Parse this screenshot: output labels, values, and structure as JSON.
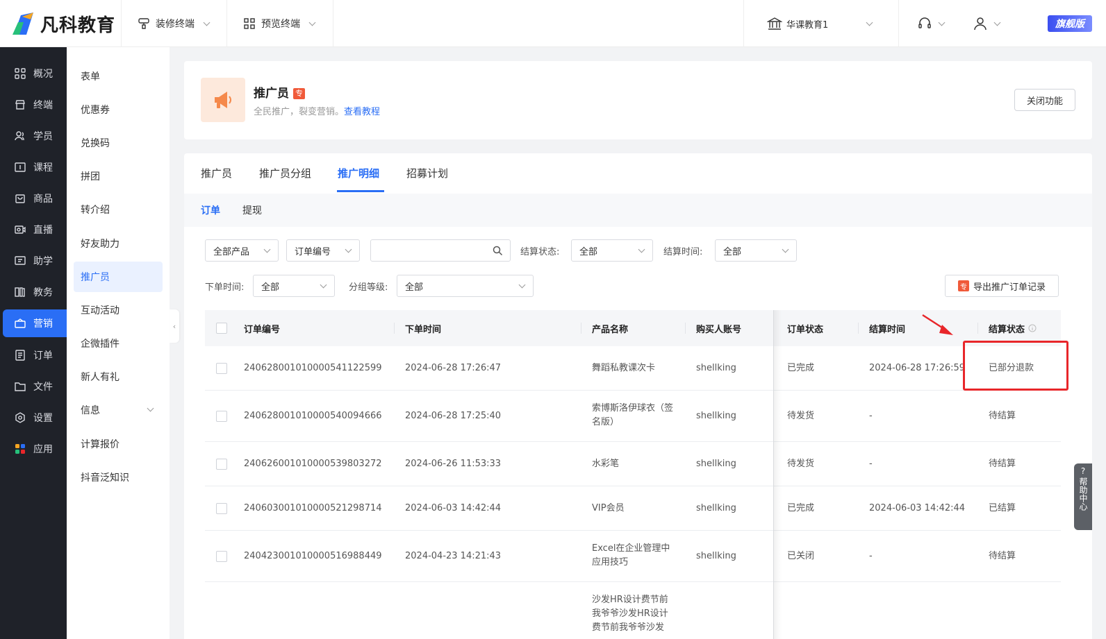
{
  "brand": {
    "name": "凡科教育"
  },
  "topbar": {
    "decorate_label": "装修终端",
    "preview_label": "预览终端",
    "org_name": "华课教育1",
    "vip_label": "旗舰版"
  },
  "nav": {
    "items": [
      {
        "label": "概况",
        "icon": "grid-icon"
      },
      {
        "label": "终端",
        "icon": "store-icon"
      },
      {
        "label": "学员",
        "icon": "users-icon"
      },
      {
        "label": "课程",
        "icon": "course-icon"
      },
      {
        "label": "商品",
        "icon": "bag-icon"
      },
      {
        "label": "直播",
        "icon": "live-icon"
      },
      {
        "label": "助学",
        "icon": "assist-icon"
      },
      {
        "label": "教务",
        "icon": "book-icon"
      },
      {
        "label": "营销",
        "icon": "marketing-icon"
      },
      {
        "label": "订单",
        "icon": "order-icon"
      },
      {
        "label": "文件",
        "icon": "folder-icon"
      },
      {
        "label": "设置",
        "icon": "gear-icon"
      },
      {
        "label": "应用",
        "icon": "apps-icon"
      }
    ],
    "active": "营销"
  },
  "subnav": {
    "items": [
      "表单",
      "优惠券",
      "兑换码",
      "拼团",
      "转介绍",
      "好友助力",
      "推广员",
      "互动活动",
      "企微插件",
      "新人有礼",
      "信息",
      "计算报价",
      "抖音泛知识"
    ],
    "active": "推广员"
  },
  "header": {
    "title": "推广员",
    "badge": "专",
    "desc": "全民推广，裂变营销。",
    "link": "查看教程",
    "close_button": "关闭功能"
  },
  "tabs": [
    "推广员",
    "推广员分组",
    "推广明细",
    "招募计划"
  ],
  "active_tab": "推广明细",
  "subtabs": [
    "订单",
    "提现"
  ],
  "active_subtab": "订单",
  "filters": {
    "product": "全部产品",
    "order_no": "订单编号",
    "search_placeholder": "",
    "settle_status_label": "结算状态:",
    "settle_status_value": "全部",
    "settle_time_label": "结算时间:",
    "settle_time_value": "全部",
    "order_time_label": "下单时间:",
    "order_time_value": "全部",
    "group_level_label": "分组等级:",
    "group_level_value": "全部",
    "export_badge": "专",
    "export_label": "导出推广订单记录"
  },
  "table": {
    "columns": [
      "订单编号",
      "下单时间",
      "产品名称",
      "购买人账号",
      "订单状态",
      "结算时间",
      "结算状态"
    ],
    "rows": [
      {
        "order_no": "24062800101000054112​2599",
        "time": "2024-06-28 17:26:47",
        "product": "舞蹈私教课次卡",
        "buyer": "shellking",
        "status": "已完成",
        "settle_time": "2024-06-28 17:26:59",
        "settle_status": "已部分退款"
      },
      {
        "order_no": "240628001010000540094666",
        "time": "2024-06-28 17:25:40",
        "product": "索博斯洛伊球衣（签名版）",
        "buyer": "shellking",
        "status": "待发货",
        "settle_time": "-",
        "settle_status": "待结算"
      },
      {
        "order_no": "240626001010000539803272",
        "time": "2024-06-26 11:53:33",
        "product": "水彩笔",
        "buyer": "shellking",
        "status": "待发货",
        "settle_time": "-",
        "settle_status": "待结算"
      },
      {
        "order_no": "240603001010000521298714",
        "time": "2024-06-03 14:42:44",
        "product": "VIP会员",
        "buyer": "shellking",
        "status": "已完成",
        "settle_time": "2024-06-03 14:42:44",
        "settle_status": "已结算"
      },
      {
        "order_no": "240423001010000516988449",
        "time": "2024-04-23 14:21:43",
        "product": "Excel在企业管理中应用技巧",
        "buyer": "shellking",
        "status": "已关闭",
        "settle_time": "-",
        "settle_status": "待结算"
      },
      {
        "order_no": "",
        "time": "",
        "product": "沙发HR设计费节前我爷爷沙发HR设计费节前我爷爷沙发",
        "buyer": "",
        "status": "",
        "settle_time": "",
        "settle_status": ""
      }
    ]
  },
  "help": {
    "label": "帮助中心"
  },
  "colors": {
    "accent": "#2a6ef5",
    "nav_bg": "#1f2229",
    "highlight": "#e8262a"
  }
}
